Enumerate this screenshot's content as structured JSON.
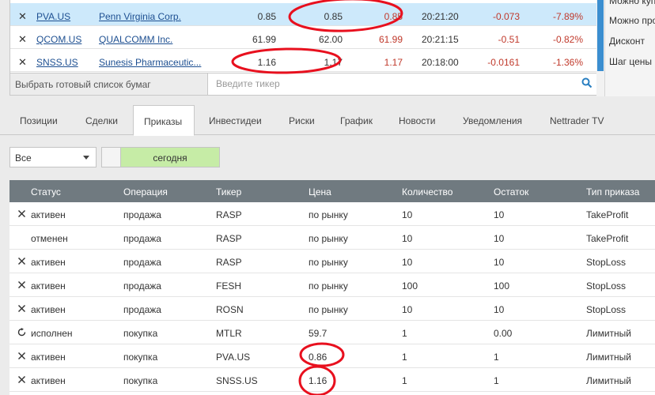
{
  "quotes": {
    "rows": [
      {
        "ticker": "PVA.US",
        "name": "Penn Virginia Corp.",
        "bid": "0.85",
        "ask": "0.85",
        "last": "0.85",
        "time": "20:21:20",
        "change": "-0.073",
        "change_pct": "-7.89%",
        "selected": true
      },
      {
        "ticker": "QCOM.US",
        "name": "QUALCOMM Inc.",
        "bid": "61.99",
        "ask": "62.00",
        "last": "61.99",
        "time": "20:21:15",
        "change": "-0.51",
        "change_pct": "-0.82%",
        "selected": false
      },
      {
        "ticker": "SNSS.US",
        "name": "Sunesis Pharmaceutic...",
        "bid": "1.16",
        "ask": "1.17",
        "last": "1.17",
        "time": "20:18:00",
        "change": "-0.0161",
        "change_pct": "-1.36%",
        "selected": false
      }
    ],
    "list_selector": "Выбрать готовый список бумаг",
    "search_placeholder": "Введите тикер"
  },
  "side_panel": {
    "items": [
      "Можно куп",
      "Можно про",
      "Дисконт",
      "Шаг цены"
    ]
  },
  "tabs": [
    {
      "label": "Позиции",
      "active": false
    },
    {
      "label": "Сделки",
      "active": false
    },
    {
      "label": "Приказы",
      "active": true
    },
    {
      "label": "Инвестидеи",
      "active": false
    },
    {
      "label": "Риски",
      "active": false
    },
    {
      "label": "График",
      "active": false
    },
    {
      "label": "Новости",
      "active": false
    },
    {
      "label": "Уведомления",
      "active": false
    },
    {
      "label": "Nettrader TV",
      "active": false
    }
  ],
  "filters": {
    "status_select": "Все",
    "period_toggle": "сегодня"
  },
  "orders": {
    "columns": [
      "Статус",
      "Операция",
      "Тикер",
      "Цена",
      "Количество",
      "Остаток",
      "Тип приказа"
    ],
    "rows": [
      {
        "icon": "close-icon",
        "status": "активен",
        "operation": "продажа",
        "ticker": "RASP",
        "price": "по рынку",
        "qty": "10",
        "remaining": "10",
        "type": "TakeProfit"
      },
      {
        "icon": "",
        "status": "отменен",
        "operation": "продажа",
        "ticker": "RASP",
        "price": "по рынку",
        "qty": "10",
        "remaining": "10",
        "type": "TakeProfit"
      },
      {
        "icon": "close-icon",
        "status": "активен",
        "operation": "продажа",
        "ticker": "RASP",
        "price": "по рынку",
        "qty": "10",
        "remaining": "10",
        "type": "StopLoss"
      },
      {
        "icon": "close-icon",
        "status": "активен",
        "operation": "продажа",
        "ticker": "FESH",
        "price": "по рынку",
        "qty": "100",
        "remaining": "100",
        "type": "StopLoss"
      },
      {
        "icon": "close-icon",
        "status": "активен",
        "operation": "продажа",
        "ticker": "ROSN",
        "price": "по рынку",
        "qty": "10",
        "remaining": "10",
        "type": "StopLoss"
      },
      {
        "icon": "refresh-icon",
        "status": "исполнен",
        "operation": "покупка",
        "ticker": "MTLR",
        "price": "59.7",
        "qty": "1",
        "remaining": "0.00",
        "type": "Лимитный"
      },
      {
        "icon": "close-icon",
        "status": "активен",
        "operation": "покупка",
        "ticker": "PVA.US",
        "price": "0.86",
        "qty": "1",
        "remaining": "1",
        "type": "Лимитный"
      },
      {
        "icon": "close-icon",
        "status": "активен",
        "operation": "покупка",
        "ticker": "SNSS.US",
        "price": "1.16",
        "qty": "1",
        "remaining": "1",
        "type": "Лимитный"
      }
    ]
  },
  "colors": {
    "selected_row": "#cde9fb",
    "link": "#1d4f91",
    "negative": "#c0392b",
    "table_header": "#707a80",
    "toggle_active": "#c6eca6",
    "scroll_thumb": "#3b8ed0",
    "annotation": "#e8101e"
  }
}
